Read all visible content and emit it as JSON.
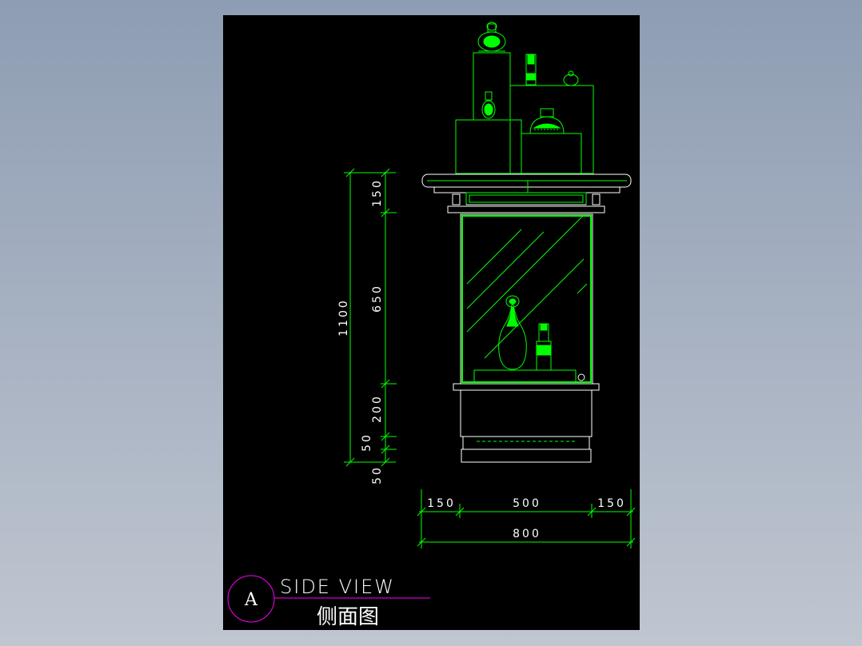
{
  "drawing": {
    "view_letter": "A",
    "view_title_en": "SIDE VIEW",
    "view_title_cn": "侧面图",
    "colors": {
      "background": "#000000",
      "line": "#00ff00",
      "bright": "#33ff33",
      "white": "#ffffff",
      "magenta": "#ff00ff"
    }
  },
  "dimensions": {
    "vertical": {
      "total": "1100",
      "top": "150",
      "glass": "650",
      "base": "200",
      "plinth_upper": "50",
      "plinth_lower": "50"
    },
    "horizontal": {
      "left": "150",
      "middle": "500",
      "right": "150",
      "total": "800"
    }
  }
}
